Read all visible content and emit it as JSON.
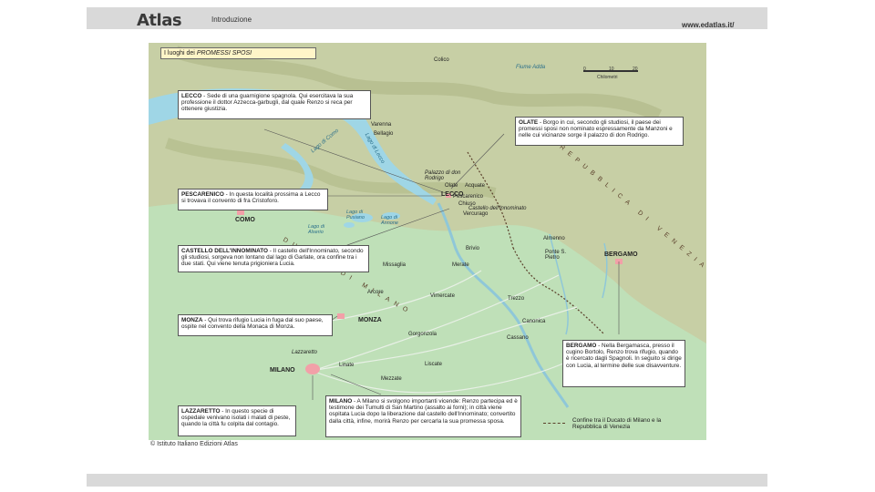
{
  "header": {
    "logo": "Atlas",
    "section": "Introduzione",
    "site": "www.edatlas.it/"
  },
  "map": {
    "title_prefix": "I luoghi dei ",
    "title_emph": "PROMESSI SPOSI",
    "scale_label": "Chilometri",
    "scale_ticks": [
      "0",
      "10",
      "20"
    ],
    "copyright": "© Istituto Italiano Edizioni Atlas",
    "legend": "Confine tra il Ducato di Milano e la Repubblica di Venezia",
    "colors": {
      "plain": "#bfe0b8",
      "hills": "#c7cfa5",
      "water": "#9fd6e6",
      "border": "#5a3f2a",
      "city": "#f2a0a8"
    },
    "regions": [
      "DUCATO DI MILANO",
      "REPUBBLICA DI VENEZIA"
    ],
    "water_labels": [
      "Lago di Como",
      "Lago di Lecco",
      "Lago di Pusiano",
      "Lago di Annone",
      "Lago di Alserio",
      "Fiume Adda"
    ],
    "cities": [
      "COMO",
      "MONZA",
      "MILANO",
      "BERGAMO",
      "LECCO"
    ],
    "places": [
      "Colico",
      "Varenna",
      "Bellagio",
      "Olate",
      "Acquate",
      "Pescarenico",
      "Chiuso",
      "Vercurago",
      "Castello dell'Innominato",
      "Palazzo di don Rodrigo",
      "Brivio",
      "Almenno",
      "Ponte S. Pietro",
      "Merate",
      "Missaglia",
      "Arcore",
      "Trezzo",
      "Vimercate",
      "Canonica",
      "Gorgonzola",
      "Cassano",
      "Linate",
      "Liscate",
      "Mezzate",
      "Lazzaretto"
    ],
    "notes": [
      {
        "title": "LECCO",
        "text": " - Sede di una guarnigione spagnola. Qui esercitava la sua professione il dottor Azzecca-garbugli, dal quale Renzo si reca per ottenere giustizia."
      },
      {
        "title": "OLATE",
        "text": " - Borgo in cui, secondo gli studiosi, il paese dei promessi sposi non nominato espressamente da Manzoni e nelle cui vicinanze sorge il palazzo di don Rodrigo."
      },
      {
        "title": "PESCARENICO",
        "text": " - In questa località prossima a Lecco si trovava il convento di fra Cristoforo."
      },
      {
        "title": "CASTELLO DELL'INNOMINATO",
        "text": " - Il castello dell'Innominato, secondo gli studiosi, sorgeva non lontano dal lago di Garlate, ora confine tra i due stati. Qui viene tenuta prigioniera Lucia."
      },
      {
        "title": "MONZA",
        "text": " - Qui trova rifugio Lucia in fuga dal suo paese, ospite nel convento della Monaca di Monza."
      },
      {
        "title": "BERGAMO",
        "text": " - Nella Bergamasca, presso il cugino Bortolo, Renzo trova rifugio, quando è ricercato dagli Spagnoli. In seguito si dirige con Lucia, al termine delle sue disavventure."
      },
      {
        "title": "LAZZARETTO",
        "text": " - In questo specie di ospedale venivano isolati i malati di peste, quando la città fu colpita dal contagio."
      },
      {
        "title": "MILANO",
        "text": " - A Milano si svolgono importanti vicende: Renzo partecipa ed è testimone dei Tumulti di San Martino (assalto ai forni); in città viene ospitata Lucia dopo la liberazione dal castello dell'Innominato; convertito dalla città, infine, morirà Renzo per cercarla la sua promessa sposa."
      }
    ]
  }
}
